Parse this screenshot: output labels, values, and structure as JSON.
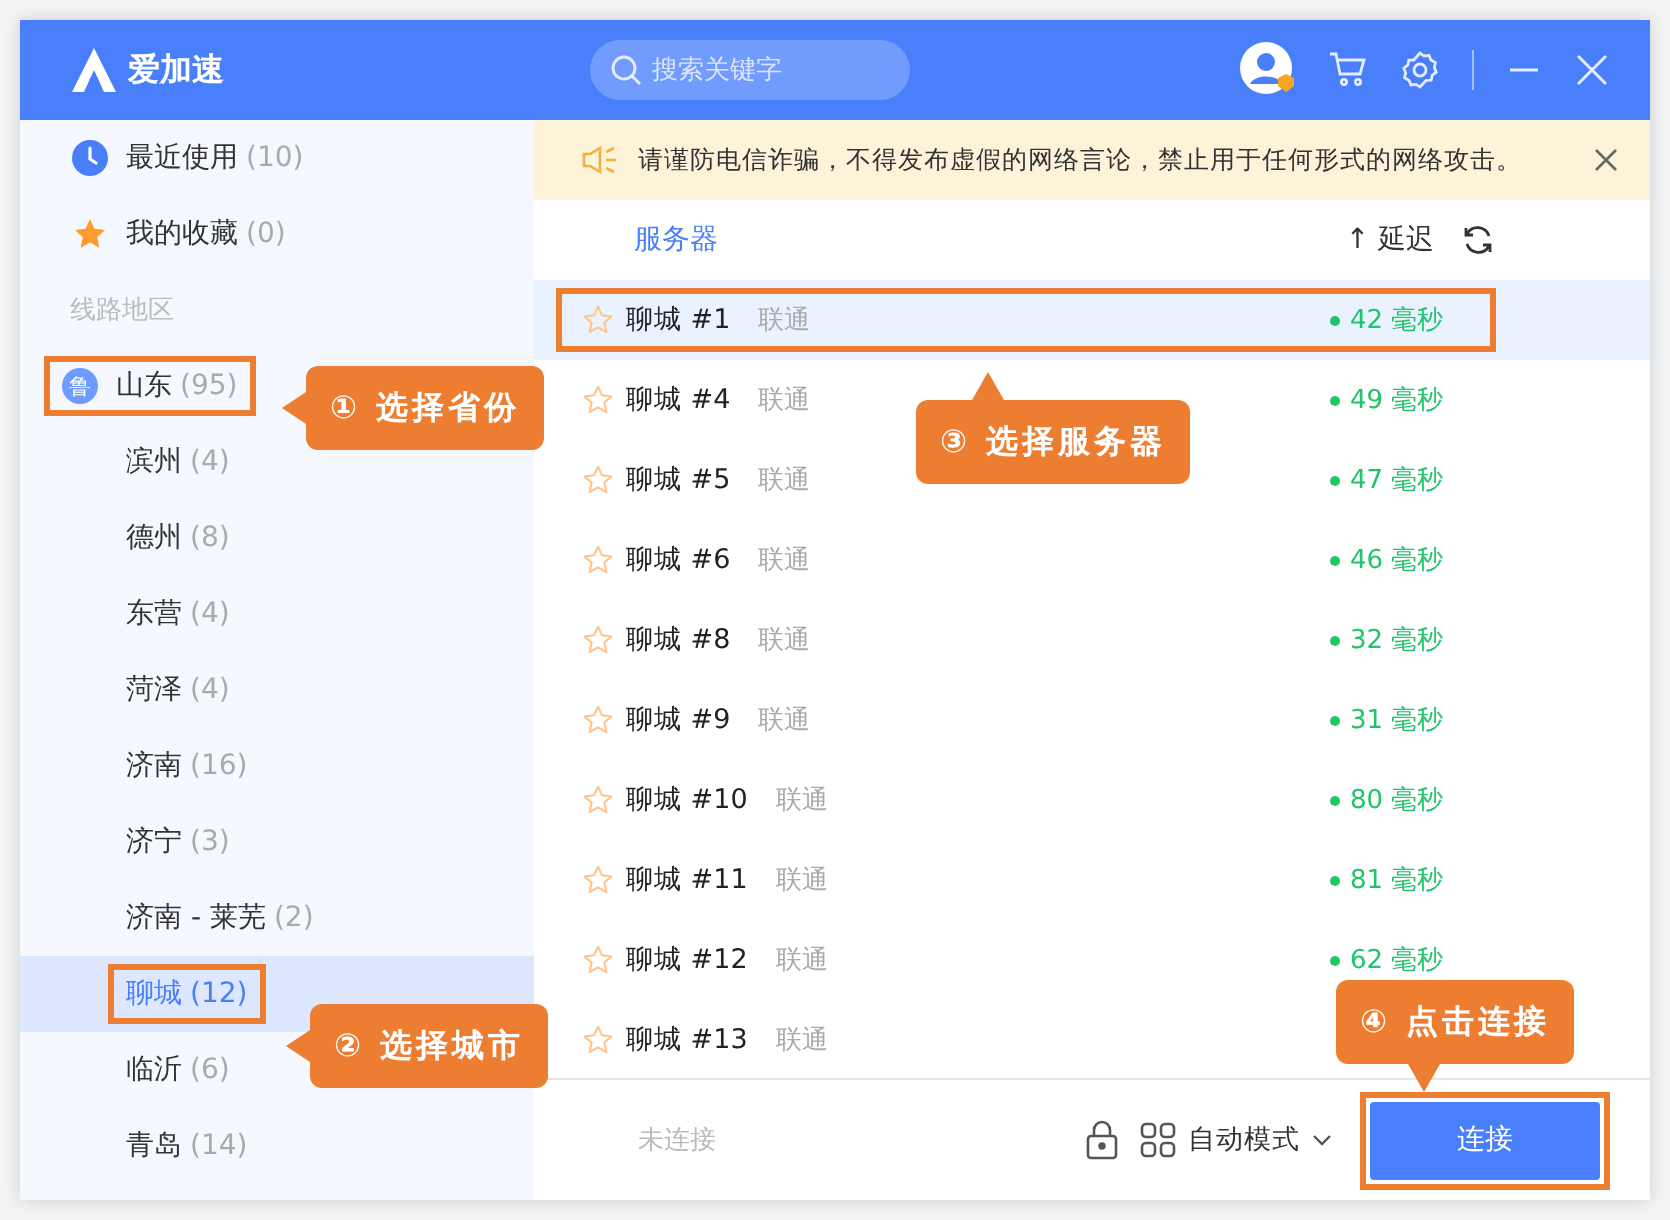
{
  "header": {
    "app_name": "爱加速",
    "search": {
      "placeholder": "搜索关键字"
    }
  },
  "sidebar": {
    "shortcuts": [
      {
        "kind": "recent",
        "label": "最近使用",
        "count": "(10)"
      },
      {
        "kind": "favorites",
        "label": "我的收藏",
        "count": "(0)"
      }
    ],
    "section_title": "线路地区",
    "province": {
      "badge": "鲁",
      "label": "山东",
      "count": "(95)",
      "highlighted": true
    },
    "cities": [
      {
        "label": "滨州",
        "count": "(4)",
        "selected": false,
        "highlighted": false
      },
      {
        "label": "德州",
        "count": "(8)",
        "selected": false,
        "highlighted": false
      },
      {
        "label": "东营",
        "count": "(4)",
        "selected": false,
        "highlighted": false
      },
      {
        "label": "菏泽",
        "count": "(4)",
        "selected": false,
        "highlighted": false
      },
      {
        "label": "济南",
        "count": "(16)",
        "selected": false,
        "highlighted": false
      },
      {
        "label": "济宁",
        "count": "(3)",
        "selected": false,
        "highlighted": false
      },
      {
        "label": "济南 - 莱芜",
        "count": "(2)",
        "selected": false,
        "highlighted": false
      },
      {
        "label": "聊城",
        "count": "(12)",
        "selected": true,
        "highlighted": true
      },
      {
        "label": "临沂",
        "count": "(6)",
        "selected": false,
        "highlighted": false
      },
      {
        "label": "青岛",
        "count": "(14)",
        "selected": false,
        "highlighted": false
      }
    ]
  },
  "notice": {
    "text": "请谨防电信诈骗，不得发布虚假的网络言论，禁止用于任何形式的网络攻击。"
  },
  "server_list": {
    "column_title": "服务器",
    "sort_label": "↑ 延迟",
    "rows": [
      {
        "name": "聊城 #1",
        "isp": "联通",
        "latency": "42 毫秒",
        "starred": false,
        "selected": true,
        "highlighted": true
      },
      {
        "name": "聊城 #4",
        "isp": "联通",
        "latency": "49 毫秒",
        "starred": false,
        "selected": false,
        "highlighted": false
      },
      {
        "name": "聊城 #5",
        "isp": "联通",
        "latency": "47 毫秒",
        "starred": false,
        "selected": false,
        "highlighted": false
      },
      {
        "name": "聊城 #6",
        "isp": "联通",
        "latency": "46 毫秒",
        "starred": false,
        "selected": false,
        "highlighted": false
      },
      {
        "name": "聊城 #8",
        "isp": "联通",
        "latency": "32 毫秒",
        "starred": false,
        "selected": false,
        "highlighted": false
      },
      {
        "name": "聊城 #9",
        "isp": "联通",
        "latency": "31 毫秒",
        "starred": false,
        "selected": false,
        "highlighted": false
      },
      {
        "name": "聊城 #10",
        "isp": "联通",
        "latency": "80 毫秒",
        "starred": false,
        "selected": false,
        "highlighted": false
      },
      {
        "name": "聊城 #11",
        "isp": "联通",
        "latency": "81 毫秒",
        "starred": false,
        "selected": false,
        "highlighted": false
      },
      {
        "name": "聊城 #12",
        "isp": "联通",
        "latency": "62 毫秒",
        "starred": false,
        "selected": false,
        "highlighted": false
      },
      {
        "name": "聊城 #13",
        "isp": "联通",
        "starred": false,
        "selected": false,
        "highlighted": false
      }
    ]
  },
  "footer": {
    "status": "未连接",
    "mode": "自动模式",
    "connect_button": {
      "label": "连接",
      "highlighted": true
    }
  },
  "callouts": [
    {
      "text": "① 选择省份"
    },
    {
      "text": "② 选择城市"
    },
    {
      "text": "③ 选择服务器"
    },
    {
      "text": "④ 点击连接"
    }
  ]
}
